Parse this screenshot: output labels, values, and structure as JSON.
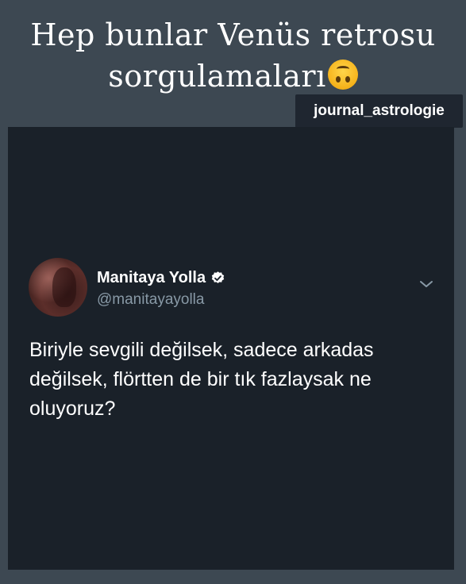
{
  "caption": {
    "line1": "Hep bunlar Venüs retrosu",
    "line2": "sorgulamaları",
    "emoji": "upside-down-face"
  },
  "watermark": {
    "text": "journal_astrologie"
  },
  "tweet": {
    "author_name": "Manitaya Yolla",
    "verified": true,
    "handle": "@manitayayolla",
    "text": "Biriyle sevgili değilsek, sadece arkadas\ndeğilsek, flörtten de bir tık fazlaysak ne\noluyoruz?",
    "menu_icon": "chevron-down-icon"
  },
  "colors": {
    "background": "#3d4852",
    "card": "#1a2129",
    "watermark_bg": "#1f2630",
    "verified_badge": "#ffffff",
    "handle": "#8899a6"
  }
}
